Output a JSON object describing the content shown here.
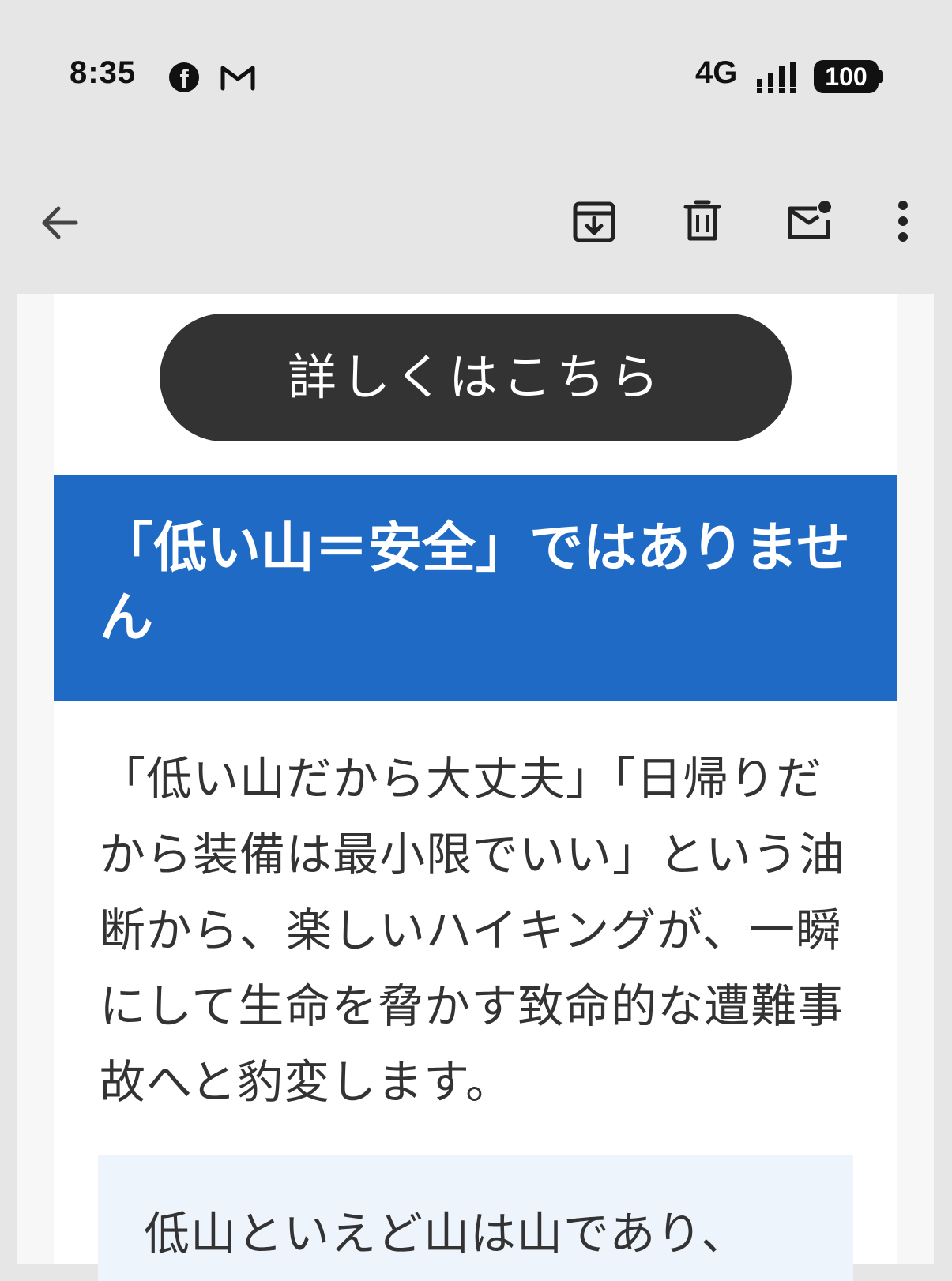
{
  "status_bar": {
    "time": "8:35",
    "network": "4G",
    "battery": "100",
    "icons": [
      "facebook-icon",
      "gmail-icon",
      "signal-icon",
      "battery-icon"
    ]
  },
  "toolbar": {
    "icons": [
      "back-arrow-icon",
      "archive-icon",
      "trash-icon",
      "mark-unread-icon",
      "more-vert-icon"
    ]
  },
  "email": {
    "cta_label": "詳しくはこちら",
    "heading": "「低い山＝安全」ではありません",
    "body": "「低い山だから大丈夫」「日帰りだから装備は最小限でいい」という油断から、楽しいハイキングが、一瞬にして生命を脅かす致命的な遭難事故へと豹変します。",
    "quote": "低山といえど山は山であり、"
  },
  "colors": {
    "header_bg": "#e6e6e6",
    "cta_bg": "#333333",
    "heading_bg": "#1f6ac5",
    "quote_bg": "#eef4fc",
    "text": "#333333"
  }
}
